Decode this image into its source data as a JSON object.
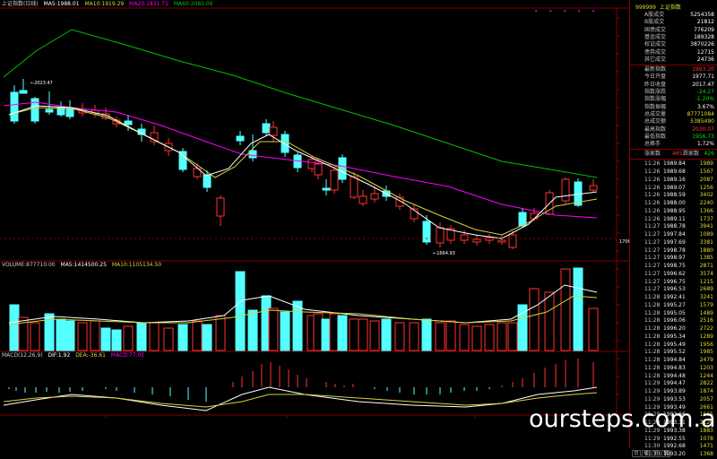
{
  "main_panel": {
    "title": "上证指数(日线)",
    "ma5": "MA5:1988.01",
    "ma10": "MA10:1919.29",
    "ma20": "MA20:1831.71",
    "ma60": "MA60:2082.06",
    "annot_high": "2023.47",
    "annot_low": "1664.93",
    "axis_label": "1706.1",
    "stars_count": 5
  },
  "volume_panel": {
    "title": "VOLUME:877710.00",
    "ma5": "MA5:1414500.25",
    "ma10": "MA10:1105134.50"
  },
  "macd_panel": {
    "title": "MACD(12,26,9)",
    "dif": "DIF:1.92",
    "dea": "DEA:-36.61",
    "macd": "MACD:77.05"
  },
  "sidebar": {
    "code": "999999",
    "name": "上证指数",
    "stats": [
      {
        "k": "A股成交",
        "v": "5254358"
      },
      {
        "k": "B股成交",
        "v": "21812"
      },
      {
        "k": "国债成交",
        "v": "776209"
      },
      {
        "k": "基金成交",
        "v": "189328"
      },
      {
        "k": "权证成交",
        "v": "3870226"
      },
      {
        "k": "债券成交",
        "v": "12715"
      },
      {
        "k": "其它成交",
        "v": "24736"
      }
    ],
    "quotes": [
      {
        "k": "最新指数",
        "v": "1993.20"
      },
      {
        "k": "今日开盘",
        "v": "1977.71"
      },
      {
        "k": "昨日收盘",
        "v": "2017.47"
      },
      {
        "k": "指数涨跌",
        "v": "-24.27"
      },
      {
        "k": "指数涨幅",
        "v": "-1.20%"
      },
      {
        "k": "指数振幅",
        "v": "3.67%"
      },
      {
        "k": "总成交量",
        "v": "87771084"
      },
      {
        "k": "总成交额",
        "v": "5385490"
      },
      {
        "k": "最高指数",
        "v": "2030.07"
      },
      {
        "k": "最低指数",
        "v": "1956.73"
      },
      {
        "k": "总换手",
        "v": "1.72%"
      }
    ],
    "updown": {
      "up_label": "涨家数",
      "up": "465",
      "down_label": "跌家数",
      "down": "426"
    },
    "ticks": [
      {
        "t": "11:26",
        "p": "1989.84",
        "q": "1989"
      },
      {
        "t": "11:26",
        "p": "1989.68",
        "q": "1567"
      },
      {
        "t": "11:26",
        "p": "1989.16",
        "q": "2087"
      },
      {
        "t": "11:26",
        "p": "1989.07",
        "q": "1256"
      },
      {
        "t": "11:26",
        "p": "1988.59",
        "q": "3402"
      },
      {
        "t": "11:26",
        "p": "1988.00",
        "q": "2240"
      },
      {
        "t": "11:26",
        "p": "1988.95",
        "q": "1366"
      },
      {
        "t": "11:26",
        "p": "1989.11",
        "q": "1737"
      },
      {
        "t": "11:27",
        "p": "1988.78",
        "q": "3941"
      },
      {
        "t": "11:27",
        "p": "1997.84",
        "q": "1089"
      },
      {
        "t": "11:27",
        "p": "1997.69",
        "q": "3381"
      },
      {
        "t": "11:27",
        "p": "1998.78",
        "q": "1880"
      },
      {
        "t": "11:27",
        "p": "1998.97",
        "q": "1385"
      },
      {
        "t": "11:27",
        "p": "1998.75",
        "q": "2871"
      },
      {
        "t": "11:27",
        "p": "1996.62",
        "q": "3574"
      },
      {
        "t": "11:27",
        "p": "1996.75",
        "q": "1215"
      },
      {
        "t": "11:27",
        "p": "1996.53",
        "q": "2689"
      },
      {
        "t": "11:28",
        "p": "1992.41",
        "q": "3241"
      },
      {
        "t": "11:28",
        "p": "1995.27",
        "q": "1579"
      },
      {
        "t": "11:28",
        "p": "1995.05",
        "q": "1489"
      },
      {
        "t": "11:28",
        "p": "1996.06",
        "q": "2516"
      },
      {
        "t": "11:28",
        "p": "1996.20",
        "q": "2722"
      },
      {
        "t": "11:28",
        "p": "1995.34",
        "q": "1289"
      },
      {
        "t": "11:28",
        "p": "1995.49",
        "q": "1956"
      },
      {
        "t": "11:28",
        "p": "1995.52",
        "q": "1985"
      },
      {
        "t": "11:28",
        "p": "1994.84",
        "q": "2479"
      },
      {
        "t": "11:28",
        "p": "1994.83",
        "q": "1203"
      },
      {
        "t": "11:28",
        "p": "1994.48",
        "q": "1244"
      },
      {
        "t": "11:29",
        "p": "1994.47",
        "q": "2822"
      },
      {
        "t": "11:29",
        "p": "1993.89",
        "q": "1874"
      },
      {
        "t": "11:29",
        "p": "1993.53",
        "q": "2057"
      },
      {
        "t": "11:29",
        "p": "1993.49",
        "q": "2661"
      },
      {
        "t": "11:29",
        "p": "1993.66",
        "q": "1665"
      },
      {
        "t": "11:29",
        "p": "1993.31",
        "q": "2120"
      },
      {
        "t": "11:29",
        "p": "1993.38",
        "q": "1883"
      },
      {
        "t": "11:29",
        "p": "1992.55",
        "q": "1078"
      },
      {
        "t": "11:30",
        "p": "1992.68",
        "q": "1471"
      },
      {
        "t": "11:30",
        "p": "1993.20",
        "q": "1368"
      }
    ]
  },
  "watermark": "oursteps.com.au",
  "bottom_buttons": [
    "日",
    "线",
    "分",
    "笔"
  ],
  "colors": {
    "up": "#ff3232",
    "down": "#54ffff",
    "ma5": "#ffffff",
    "ma10": "#d4d43c",
    "ma20": "#ff00ff",
    "ma60": "#00c000",
    "frame": "#800000"
  }
}
